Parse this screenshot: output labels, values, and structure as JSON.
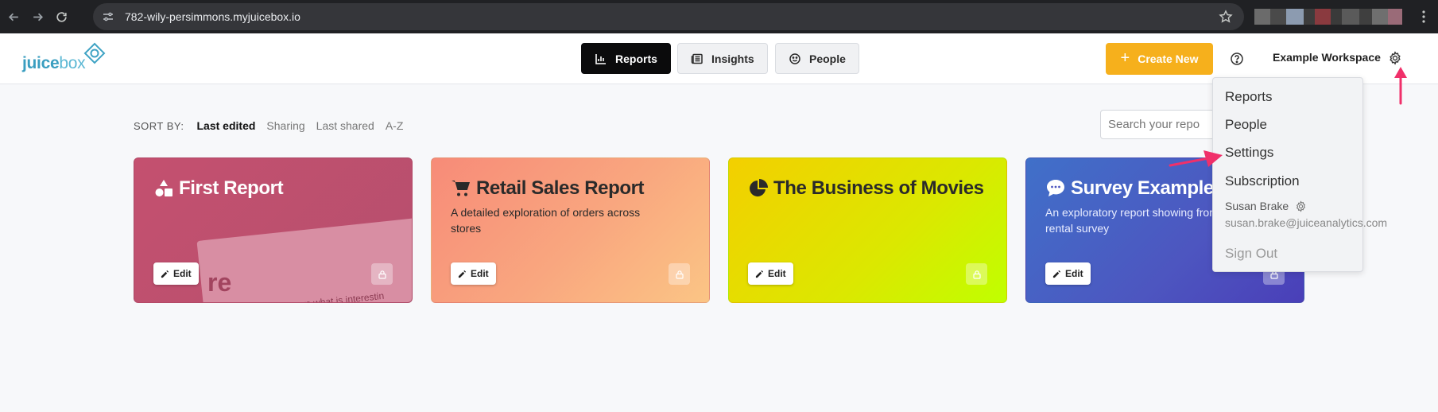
{
  "browser": {
    "url": "782-wily-persimmons.myjuicebox.io"
  },
  "header": {
    "logo_bold": "juice",
    "logo_light": "box",
    "tabs": [
      {
        "label": "Reports",
        "active": true
      },
      {
        "label": "Insights",
        "active": false
      },
      {
        "label": "People",
        "active": false
      }
    ],
    "create_label": "Create New",
    "workspace_label": "Example Workspace"
  },
  "sort": {
    "label": "SORT BY:",
    "options": [
      "Last edited",
      "Sharing",
      "Last shared",
      "A-Z"
    ],
    "active": "Last edited"
  },
  "search": {
    "placeholder": "Search your repo"
  },
  "cards": [
    {
      "title": "First Report",
      "description": "",
      "edit_label": "Edit",
      "icon": "shapes-icon",
      "preview_big": "re",
      "preview_small": "...ers what is interestin"
    },
    {
      "title": "Retail Sales Report",
      "description": "A detailed exploration of orders across stores",
      "edit_label": "Edit",
      "icon": "cart-icon"
    },
    {
      "title": "The Business of Movies",
      "description": "",
      "edit_label": "Edit",
      "icon": "pie-icon"
    },
    {
      "title": "Survey Example",
      "description": "An exploratory report showing from a car rental survey",
      "edit_label": "Edit",
      "icon": "speech-bubble-icon"
    }
  ],
  "menu": {
    "items": [
      "Reports",
      "People",
      "Settings",
      "Subscription"
    ],
    "user_name": "Susan Brake",
    "user_email": "susan.brake@juiceanalytics.com",
    "sign_out": "Sign Out"
  },
  "colors": {
    "accent": "#f6b01c",
    "brand": "#3fa3c4",
    "annotation": "#f0306a"
  }
}
